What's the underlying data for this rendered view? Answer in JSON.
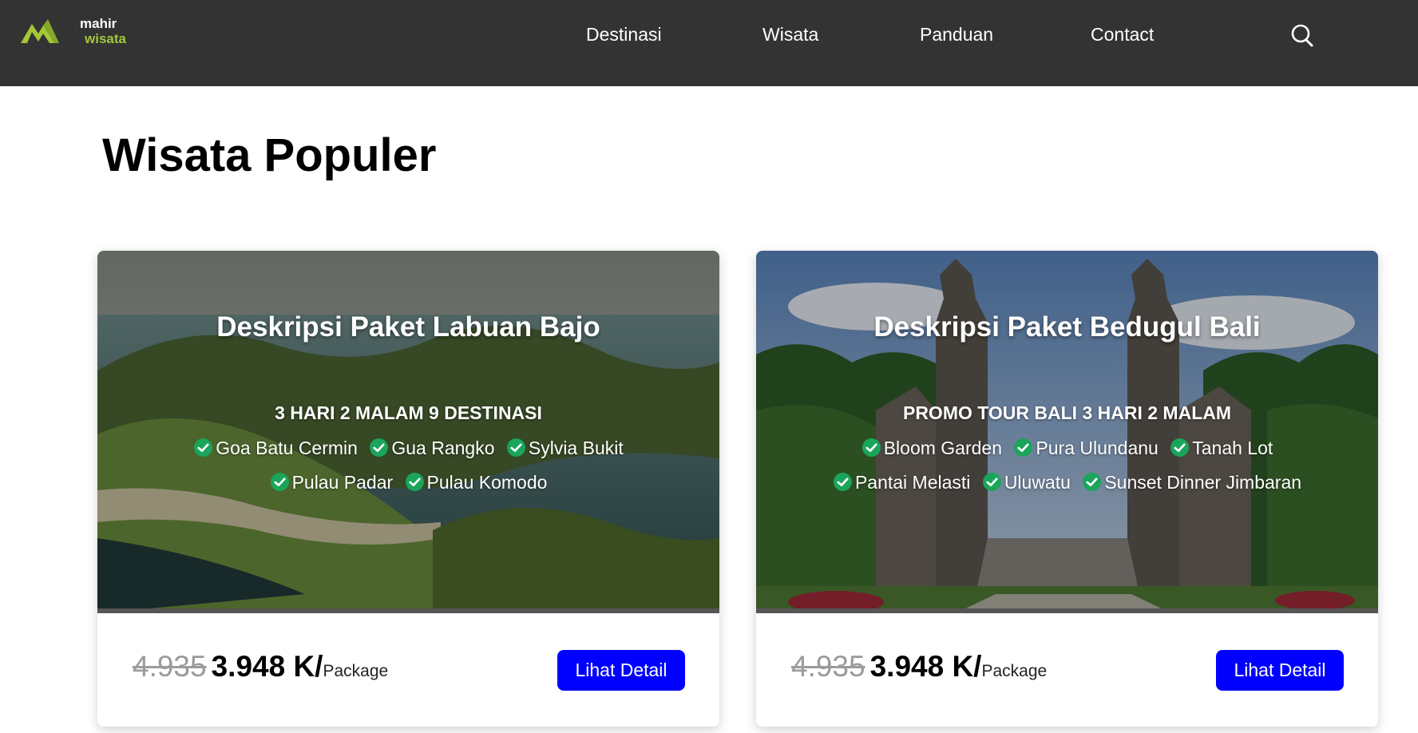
{
  "brand": {
    "logo_line1": "mahir",
    "logo_line2": "wisata",
    "logo_icon": "mountain-logo-icon"
  },
  "nav": {
    "items": [
      {
        "label": "Destinasi"
      },
      {
        "label": "Wisata"
      },
      {
        "label": "Panduan"
      },
      {
        "label": "Contact"
      }
    ],
    "search_icon": "search-icon"
  },
  "section": {
    "title": "Wisata Populer"
  },
  "cards": [
    {
      "title": "Deskripsi Paket Labuan Bajo",
      "subtitle": "3 HARI 2 MALAM 9 DESTINASI",
      "destinations_row1": [
        "Goa Batu Cermin",
        "Gua Rangko",
        "Sylvia Bukit"
      ],
      "destinations_row2": [
        "Pulau Padar",
        "Pulau Komodo"
      ],
      "old_price": "4.935",
      "new_price": "3.948 K/",
      "unit": "Package",
      "button_label": "Lihat Detail"
    },
    {
      "title": "Deskripsi Paket Bedugul Bali",
      "subtitle": "PROMO TOUR BALI 3 HARI 2 MALAM",
      "destinations_row1": [
        "Bloom Garden",
        "Pura Ulundanu",
        "Tanah Lot"
      ],
      "destinations_row2": [
        "Pantai Melasti",
        "Uluwatu",
        "Sunset Dinner Jimbaran"
      ],
      "old_price": "4.935",
      "new_price": "3.948 K/",
      "unit": "Package",
      "button_label": "Lihat Detail"
    }
  ],
  "colors": {
    "navbar_bg": "#333333",
    "brand_green": "#a4c639",
    "check_green": "#1aa55a",
    "button_blue": "#0000ff",
    "old_price_gray": "#9b9b9b"
  }
}
